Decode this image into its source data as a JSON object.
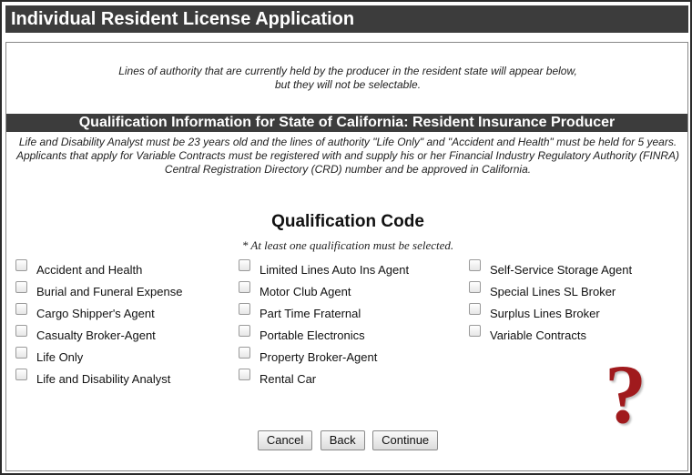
{
  "header": {
    "title": "Individual Resident License Application"
  },
  "intro": {
    "line1": "Lines of authority that are currently held by the producer in the resident state will appear below,",
    "line2": "but they will not be selectable."
  },
  "section": {
    "title": "Qualification Information for State of California: Resident Insurance Producer",
    "note1": "Life and Disability Analyst must be 23 years old and the lines of authority \"Life Only\" and \"Accident and Health\" must be held for 5 years.",
    "note2": "Applicants that apply for Variable Contracts must be registered with and supply his or her Financial Industry Regulatory Authority (FINRA) Central Registration Directory (CRD) number and be approved in California."
  },
  "qualification": {
    "heading": "Qualification Code",
    "note": "* At least one qualification must be selected.",
    "columns": [
      [
        "Accident and Health",
        "Burial and Funeral Expense",
        "Cargo Shipper's Agent",
        "Casualty Broker-Agent",
        "Life Only",
        "Life and Disability Analyst"
      ],
      [
        "Limited Lines Auto Ins Agent",
        "Motor Club Agent",
        "Part Time Fraternal",
        "Portable Electronics",
        "Property Broker-Agent",
        "Rental Car"
      ],
      [
        "Self-Service Storage Agent",
        "Special Lines SL Broker",
        "Surplus Lines Broker",
        "Variable Contracts"
      ]
    ]
  },
  "help_icon": {
    "glyph": "?",
    "color": "#a01a1d"
  },
  "buttons": {
    "cancel": "Cancel",
    "back": "Back",
    "continue": "Continue"
  }
}
